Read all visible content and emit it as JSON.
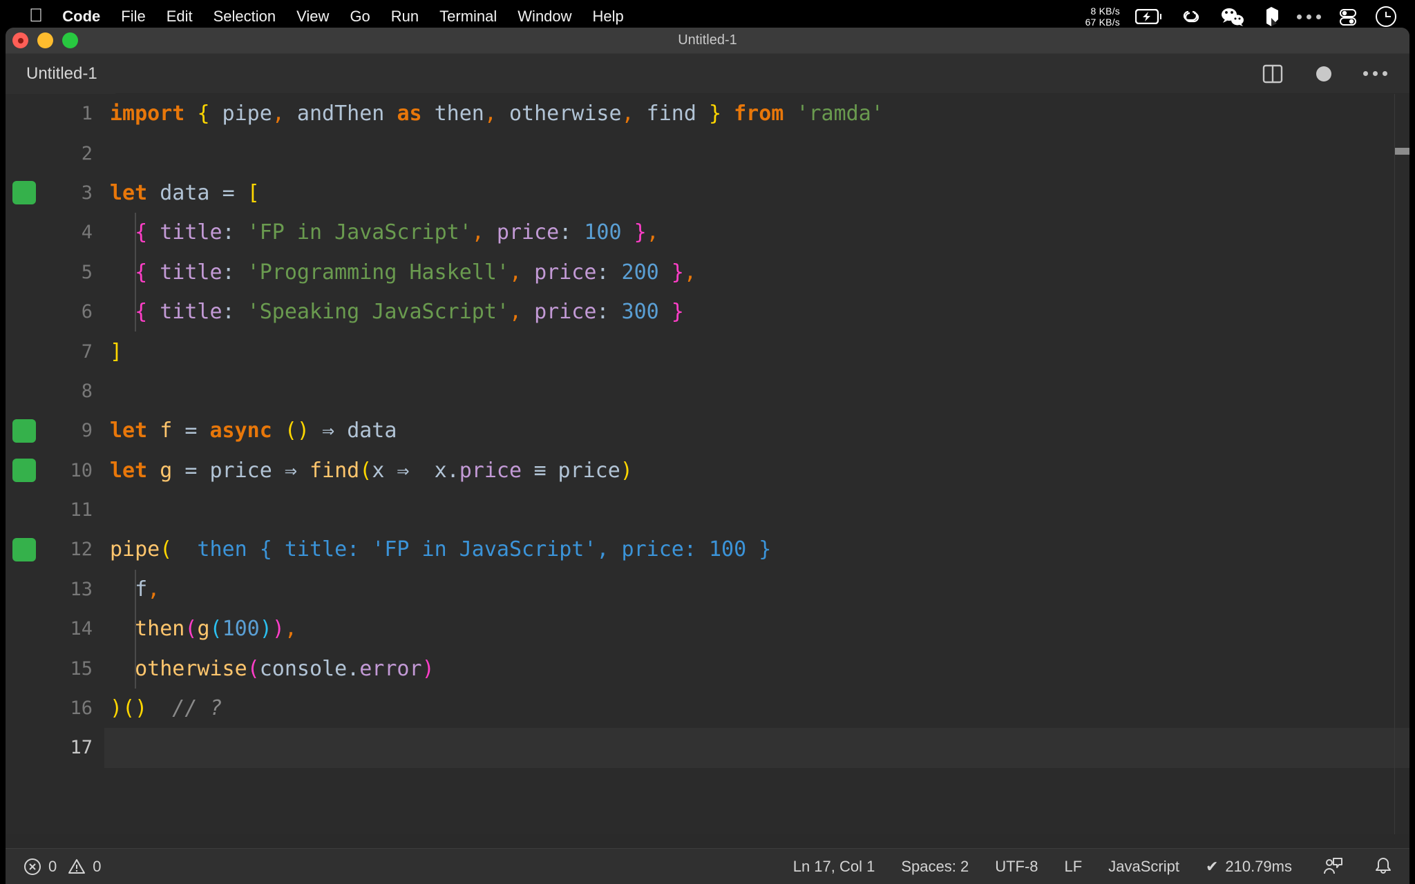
{
  "menubar": {
    "apple_icon": "apple-logo-icon",
    "items": [
      "Code",
      "File",
      "Edit",
      "Selection",
      "View",
      "Go",
      "Run",
      "Terminal",
      "Window",
      "Help"
    ],
    "network_up": "8 KB/s",
    "network_down": "67 KB/s",
    "status_icons": [
      "battery-charging-icon",
      "link-icon",
      "wechat-icon",
      "bartender-icon",
      "ellipsis-icon",
      "toggles-icon",
      "control-center-icon"
    ]
  },
  "window": {
    "title": "Untitled-1",
    "traffic_lights": [
      "close-button",
      "minimize-button",
      "zoom-button"
    ]
  },
  "tabbar": {
    "tab_label": "Untitled-1",
    "actions": [
      "split-editor-icon",
      "unsaved-dot-icon",
      "more-actions-icon"
    ]
  },
  "editor": {
    "language": "JavaScript",
    "active_line": 17,
    "lines": [
      {
        "n": 1,
        "marker": false,
        "indent": false
      },
      {
        "n": 2,
        "marker": false,
        "indent": false
      },
      {
        "n": 3,
        "marker": true,
        "indent": false
      },
      {
        "n": 4,
        "marker": false,
        "indent": true
      },
      {
        "n": 5,
        "marker": false,
        "indent": true
      },
      {
        "n": 6,
        "marker": false,
        "indent": true
      },
      {
        "n": 7,
        "marker": false,
        "indent": false
      },
      {
        "n": 8,
        "marker": false,
        "indent": false
      },
      {
        "n": 9,
        "marker": true,
        "indent": false
      },
      {
        "n": 10,
        "marker": true,
        "indent": false
      },
      {
        "n": 11,
        "marker": false,
        "indent": false
      },
      {
        "n": 12,
        "marker": true,
        "indent": false
      },
      {
        "n": 13,
        "marker": false,
        "indent": true
      },
      {
        "n": 14,
        "marker": false,
        "indent": true
      },
      {
        "n": 15,
        "marker": false,
        "indent": true
      },
      {
        "n": 16,
        "marker": false,
        "indent": false
      },
      {
        "n": 17,
        "marker": false,
        "indent": false
      }
    ],
    "source": {
      "l1_import": "import",
      "l1_brace_open": "{",
      "l1_pipe": " pipe",
      "l1_c1": ",",
      "l1_andthen": " andThen ",
      "l1_as": "as",
      "l1_then": " then",
      "l1_c2": ",",
      "l1_otherwise": " otherwise",
      "l1_c3": ",",
      "l1_find": " find ",
      "l1_brace_close": "}",
      "l1_from": "from",
      "l1_module": "'ramda'",
      "l3_let": "let",
      "l3_data": " data ",
      "l3_eq": "=",
      "l3_bracket": "[",
      "l4_open": "{",
      "l4_title": " title",
      "l4_colon": ":",
      "l4_str": " 'FP in JavaScript'",
      "l4_comma": ",",
      "l4_price": " price",
      "l4_colon2": ":",
      "l4_num": " 100 ",
      "l4_close": "}",
      "l4_trail": ",",
      "l5_open": "{",
      "l5_title": " title",
      "l5_colon": ":",
      "l5_str": " 'Programming Haskell'",
      "l5_comma": ",",
      "l5_price": " price",
      "l5_colon2": ":",
      "l5_num": " 200 ",
      "l5_close": "}",
      "l5_trail": ",",
      "l6_open": "{",
      "l6_title": " title",
      "l6_colon": ":",
      "l6_str": " 'Speaking JavaScript'",
      "l6_comma": ",",
      "l6_price": " price",
      "l6_colon2": ":",
      "l6_num": " 300 ",
      "l6_close": "}",
      "l7_bracket": "]",
      "l9_let": "let",
      "l9_f": " f ",
      "l9_eq": "= ",
      "l9_async": "async",
      "l9_parens": " ()",
      "l9_arrow": " ⇒ ",
      "l9_data": "data",
      "l10_let": "let",
      "l10_g": " g ",
      "l10_eq": "= ",
      "l10_price": "price",
      "l10_arrow": " ⇒ ",
      "l10_find": "find",
      "l10_paren": "(",
      "l10_x": "x",
      "l10_arrow2": " ⇒ ",
      "l10_xdot": " x.",
      "l10_prop": "price",
      "l10_eqeq": " ≡ ",
      "l10_price2": "price",
      "l10_close": ")",
      "l12_pipe": "pipe",
      "l12_paren": "(",
      "l12_hint": "  then { title: 'FP in JavaScript', price: 100 }",
      "l13_f": "f",
      "l13_comma": ",",
      "l14_then": "then",
      "l14_p1": "(",
      "l14_g": "g",
      "l14_p2": "(",
      "l14_num": "100",
      "l14_p2c": ")",
      "l14_p1c": ")",
      "l14_comma": ",",
      "l15_otherwise": "otherwise",
      "l15_p": "(",
      "l15_console": "console.",
      "l15_error": "error",
      "l15_pc": ")",
      "l16_close": ")",
      "l16_call": "()",
      "l16_comment": "  // ?"
    }
  },
  "statusbar": {
    "errors_icon": "error-circle-icon",
    "errors": "0",
    "warnings_icon": "warning-triangle-icon",
    "warnings": "0",
    "cursor": "Ln 17, Col 1",
    "indentation": "Spaces: 2",
    "encoding": "UTF-8",
    "eol": "LF",
    "language": "JavaScript",
    "quokka_icon": "check-icon",
    "quokka_time": "210.79ms",
    "feedback_icon": "feedback-icon",
    "bell_icon": "bell-icon"
  },
  "colors": {
    "editor_bg": "#2b2b2b",
    "tab_bg": "#2f2f2f",
    "title_bg": "#3b3b3b",
    "status_bg": "#303030",
    "keyword": "#e8770a",
    "string": "#6a9b4f",
    "number": "#5a9fd4",
    "function": "#ffc66d",
    "property": "#c39ad6",
    "variable": "#b2c4d6",
    "comment": "#8a8a8a",
    "hint": "#3b94d9",
    "gutter_marker": "#35b14b",
    "bracket_yellow": "#ffd700",
    "bracket_pink": "#ff3ec8",
    "bracket_blue": "#2bc0f0"
  }
}
